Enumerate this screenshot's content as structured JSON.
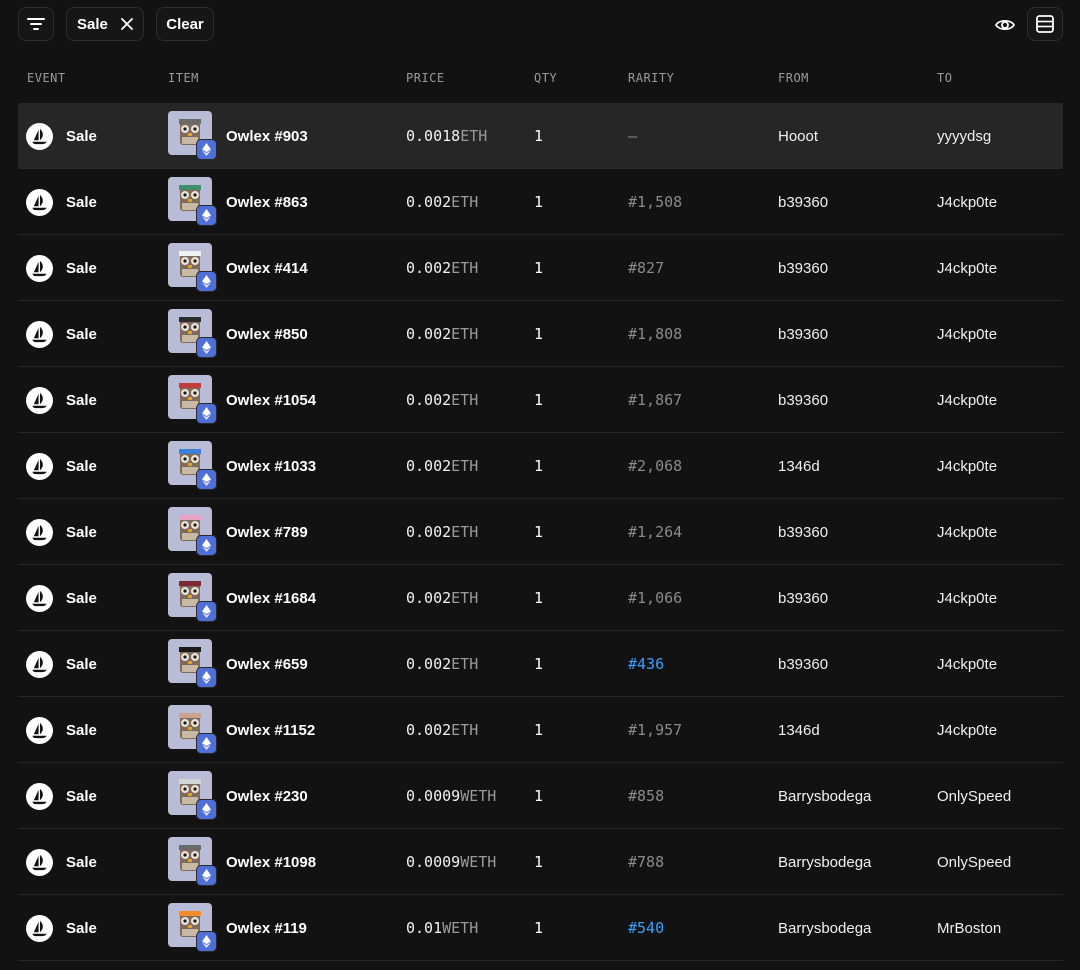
{
  "toolbar": {
    "filter_icon": "filter-lines-icon",
    "chip_label": "Sale",
    "chip_close_icon": "close-icon",
    "clear_label": "Clear",
    "visibility_icon": "eye-icon",
    "layout_icon": "table-layout-icon"
  },
  "columns": {
    "event": "EVENT",
    "item": "ITEM",
    "price": "PRICE",
    "qty": "QTY",
    "rarity": "RARITY",
    "from": "FROM",
    "to": "TO"
  },
  "colors": {
    "background": "#121212",
    "active_row": "#262626",
    "link": "#3aa0ff",
    "eth_badge": "#4f6fd8"
  },
  "rows": [
    {
      "event": "Sale",
      "item": "Owlex #903",
      "price": "0.0018",
      "currency": "ETH",
      "qty": "1",
      "rarity": "–",
      "rarity_link": false,
      "from": "Hooot",
      "to": "yyyydsg",
      "active": true
    },
    {
      "event": "Sale",
      "item": "Owlex #863",
      "price": "0.002",
      "currency": "ETH",
      "qty": "1",
      "rarity": "#1,508",
      "rarity_link": false,
      "from": "b39360",
      "to": "J4ckp0te"
    },
    {
      "event": "Sale",
      "item": "Owlex #414",
      "price": "0.002",
      "currency": "ETH",
      "qty": "1",
      "rarity": "#827",
      "rarity_link": false,
      "from": "b39360",
      "to": "J4ckp0te"
    },
    {
      "event": "Sale",
      "item": "Owlex #850",
      "price": "0.002",
      "currency": "ETH",
      "qty": "1",
      "rarity": "#1,808",
      "rarity_link": false,
      "from": "b39360",
      "to": "J4ckp0te"
    },
    {
      "event": "Sale",
      "item": "Owlex #1054",
      "price": "0.002",
      "currency": "ETH",
      "qty": "1",
      "rarity": "#1,867",
      "rarity_link": false,
      "from": "b39360",
      "to": "J4ckp0te"
    },
    {
      "event": "Sale",
      "item": "Owlex #1033",
      "price": "0.002",
      "currency": "ETH",
      "qty": "1",
      "rarity": "#2,068",
      "rarity_link": false,
      "from": "1346d",
      "to": "J4ckp0te"
    },
    {
      "event": "Sale",
      "item": "Owlex #789",
      "price": "0.002",
      "currency": "ETH",
      "qty": "1",
      "rarity": "#1,264",
      "rarity_link": false,
      "from": "b39360",
      "to": "J4ckp0te"
    },
    {
      "event": "Sale",
      "item": "Owlex #1684",
      "price": "0.002",
      "currency": "ETH",
      "qty": "1",
      "rarity": "#1,066",
      "rarity_link": false,
      "from": "b39360",
      "to": "J4ckp0te"
    },
    {
      "event": "Sale",
      "item": "Owlex #659",
      "price": "0.002",
      "currency": "ETH",
      "qty": "1",
      "rarity": "#436",
      "rarity_link": true,
      "from": "b39360",
      "to": "J4ckp0te"
    },
    {
      "event": "Sale",
      "item": "Owlex #1152",
      "price": "0.002",
      "currency": "ETH",
      "qty": "1",
      "rarity": "#1,957",
      "rarity_link": false,
      "from": "1346d",
      "to": "J4ckp0te"
    },
    {
      "event": "Sale",
      "item": "Owlex #230",
      "price": "0.0009",
      "currency": "WETH",
      "qty": "1",
      "rarity": "#858",
      "rarity_link": false,
      "from": "Barrysbodega",
      "to": "OnlySpeed"
    },
    {
      "event": "Sale",
      "item": "Owlex #1098",
      "price": "0.0009",
      "currency": "WETH",
      "qty": "1",
      "rarity": "#788",
      "rarity_link": false,
      "from": "Barrysbodega",
      "to": "OnlySpeed"
    },
    {
      "event": "Sale",
      "item": "Owlex #119",
      "price": "0.01",
      "currency": "WETH",
      "qty": "1",
      "rarity": "#540",
      "rarity_link": true,
      "from": "Barrysbodega",
      "to": "MrBoston"
    }
  ]
}
